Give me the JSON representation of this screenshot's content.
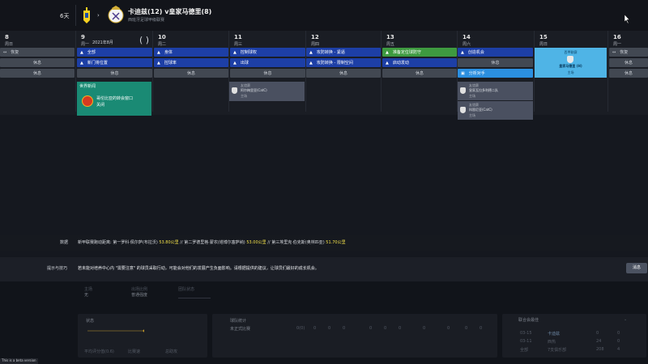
{
  "header": {
    "days_label": "6天",
    "match_title": "卡迪兹(12) v皇家马德里(8)",
    "match_subtitle": "西班牙足球甲级联赛"
  },
  "calendar": {
    "columns": [
      {
        "day": "8",
        "weekday": "周日"
      },
      {
        "day": "9",
        "weekday": "周一",
        "extra": "2021年8月"
      },
      {
        "day": "10",
        "weekday": "周二"
      },
      {
        "day": "11",
        "weekday": "周三"
      },
      {
        "day": "12",
        "weekday": "周四"
      },
      {
        "day": "13",
        "weekday": "周五"
      },
      {
        "day": "14",
        "weekday": "周六"
      },
      {
        "day": "15",
        "weekday": "周日"
      },
      {
        "day": "16",
        "weekday": "周一"
      }
    ],
    "col8": [
      "恢复",
      "休息",
      "休息"
    ],
    "col9": [
      "全部",
      "新门将位置",
      "休息"
    ],
    "col10": [
      "身体",
      "控球率",
      "休息"
    ],
    "col11": [
      "控制球权",
      "出球",
      "休息"
    ],
    "col12": [
      "攻防转换 - 紧逼",
      "攻防转换 - 限制空间",
      "休息"
    ],
    "col13": [
      "准备定位球防守",
      "启动发动",
      "休息"
    ],
    "col14": [
      "创造机会",
      "休息",
      "分析对手"
    ],
    "col16": [
      "恢复",
      "休息",
      "休息"
    ],
    "match_card": {
      "line1": "西甲联赛",
      "line2": "皇家马德里 (H)",
      "line3": "主场"
    },
    "news": {
      "title": "世界新闻",
      "line1": "哥伦比亚的转会窗口",
      "line2": "关闭"
    },
    "fixture11": {
      "line1": "友谊赛",
      "line2": "阿尔梅里亚(CatC)",
      "line3": "主场"
    },
    "fixture14a": {
      "line1": "友谊赛",
      "line2": "皇家瓦拉多利德二队",
      "line3": "主场"
    },
    "fixture14b": {
      "line1": "友谊赛",
      "line2": "科恩尼亚(CatC)",
      "line3": "主场"
    }
  },
  "data_row": {
    "label": "数据",
    "prefix": "新甲联赛跑动距离: 第一罗科·佩尔萨(布拉沃) ",
    "v1": "53.80公里",
    "mid1": " // 第二罗德里格·蒙农(塔博尔塞萨纳) ",
    "v2": "53.00公里",
    "mid2": " // 第三埃里克·伯克斯(奥林匹亚) ",
    "v3": "51.70公里"
  },
  "tips": {
    "label": "提示与技巧",
    "text": "若未能对培养中心内 \"需要注意\" 的球员采取行动，可能会对他们的发展产生负面影响。请根据提供的建议，让球员们最好的成长机会。",
    "button": "消息"
  },
  "bottom": {
    "s1_label": "主场",
    "s1_value": "无",
    "s2_label": "出场比例",
    "s2_value": "普通强度",
    "s3_label": "团队状态",
    "p1_label": "状态",
    "p2_label": "球队统计",
    "p3_label": "联合会最佳",
    "p2_row": "未正式比赛",
    "p2_values": [
      "0(0)",
      "0",
      "0",
      "0",
      "0",
      "0",
      "0",
      "0",
      "0",
      "0",
      "0"
    ],
    "p3_rows": [
      {
        "a": "03-15",
        "team": "卡迪兹",
        "v1": "0",
        "v2": "0"
      },
      {
        "a": "03-11",
        "team": "西热",
        "v1": "24",
        "v2": "0"
      },
      {
        "a": "全部",
        "team": "7支俱乐部",
        "v1": "208",
        "v2": "4"
      }
    ],
    "legend": [
      "平均评分值(0.6)",
      "比赛速",
      "总助攻"
    ]
  },
  "beta": "This is a beta version"
}
